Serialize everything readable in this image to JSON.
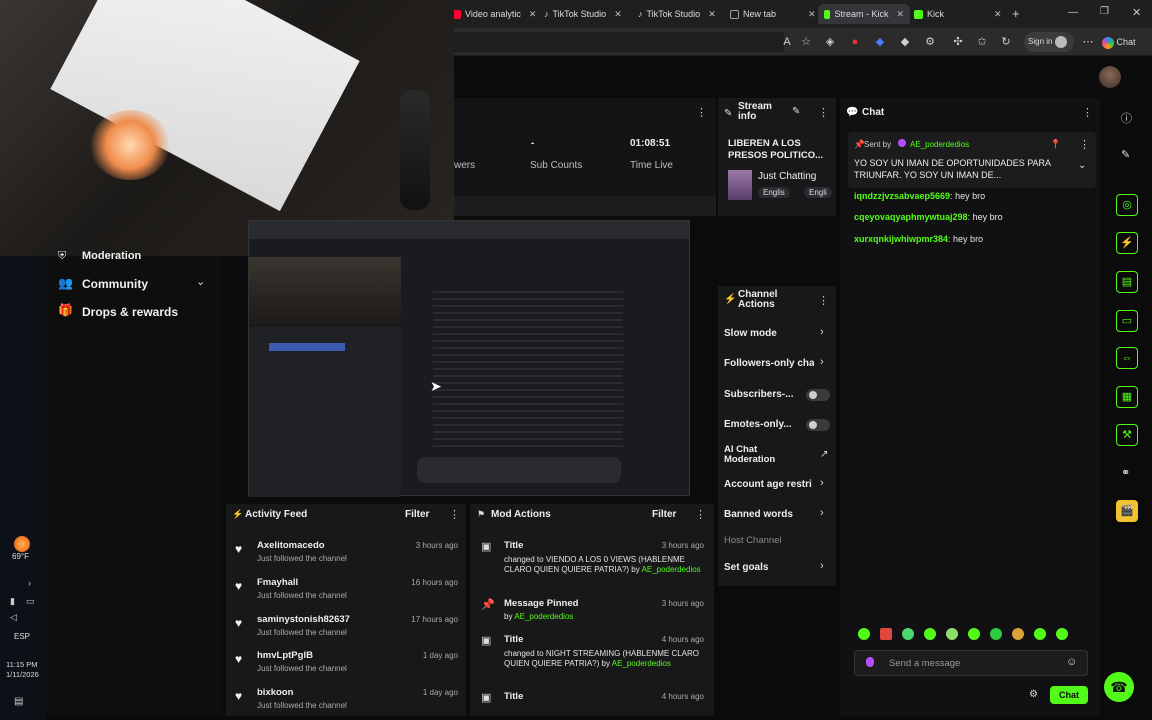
{
  "browser": {
    "tabs": [
      {
        "label": "Video analytic",
        "color": "#ff0033"
      },
      {
        "label": "TikTok Studio",
        "color": "#ffffff"
      },
      {
        "label": "TikTok Studio",
        "color": "#ffffff"
      },
      {
        "label": "New tab",
        "color": "#9aa0a6"
      },
      {
        "label": "Stream - Kick",
        "color": "#53fc18"
      },
      {
        "label": "Kick",
        "color": "#53fc18"
      }
    ],
    "sign_in": "Sign in",
    "chat_label": "Chat"
  },
  "stats": {
    "viewers_value": "-",
    "viewers_label": "wers",
    "subs_value": "-",
    "subs_label": "Sub Counts",
    "time_value": "01:08:51",
    "time_label": "Time Live"
  },
  "sidebar": {
    "items": [
      "Moderation",
      "Community",
      "Drops & rewards"
    ]
  },
  "stream_info": {
    "header": "Stream info",
    "title": "LIBEREN A LOS PRESOS POLITICO...",
    "category": "Just Chatting",
    "tags": [
      "Englis",
      "Engli"
    ]
  },
  "channel_actions": {
    "header": "Channel Actions",
    "items": [
      {
        "label": "Slow mode",
        "kind": "chevron"
      },
      {
        "label": "Followers-only cha",
        "kind": "chevron"
      },
      {
        "label": "Subscribers-...",
        "kind": "toggle"
      },
      {
        "label": "Emotes-only...",
        "kind": "toggle"
      },
      {
        "label": "AI Chat Moderation",
        "kind": "external"
      },
      {
        "label": "Account age restri",
        "kind": "chevron"
      },
      {
        "label": "Banned words",
        "kind": "chevron"
      },
      {
        "label": "Host Channel",
        "kind": "disabled"
      },
      {
        "label": "Set goals",
        "kind": "chevron"
      }
    ]
  },
  "chat": {
    "header": "Chat",
    "pinned_sender_prefix": "Sent by",
    "pinned_sender": "AE_poderdedios",
    "pinned_text": "YO SOY UN IMAN DE OPORTUNIDADES PARA TRIUNFAR. YO SOY UN IMAN DE...",
    "messages": [
      {
        "user": "iqndzzjvzsabvaep5669",
        "text": "hey bro"
      },
      {
        "user": "cqeyovaqyaphmywtuaj298",
        "text": "hey bro"
      },
      {
        "user": "xurxqnkijwhiwpmr384",
        "text": "hey bro"
      }
    ],
    "input_placeholder": "Send a message",
    "send_label": "Chat"
  },
  "activity_feed": {
    "header": "Activity Feed",
    "filter": "Filter",
    "items": [
      {
        "name": "Axelitomacedo",
        "sub": "Just followed the channel",
        "time": "3 hours ago"
      },
      {
        "name": "Fmayhall",
        "sub": "Just followed the channel",
        "time": "16 hours ago"
      },
      {
        "name": "saminystonish82637",
        "sub": "Just followed the channel",
        "time": "17 hours ago"
      },
      {
        "name": "hmvLptPglB",
        "sub": "Just followed the channel",
        "time": "1 day ago"
      },
      {
        "name": "bixkoon",
        "sub": "Just followed the channel",
        "time": "1 day ago"
      }
    ]
  },
  "mod_actions": {
    "header": "Mod Actions",
    "filter": "Filter",
    "items": [
      {
        "title": "Title",
        "body": "changed to VIENDO A LOS 0 VIEWS (HABLENME CLARO QUIEN QUIERE PATRIA?) by",
        "by": "AE_poderdedios",
        "time": "3 hours ago"
      },
      {
        "title": "Message Pinned",
        "body": "by",
        "by": "AE_poderdedios",
        "time": "3 hours ago"
      },
      {
        "title": "Title",
        "body": "changed to NIGHT STREAMING (HABLENME CLARO QUIEN QUIERE PATRIA?) by",
        "by": "AE_poderdedios",
        "time": "4 hours ago"
      },
      {
        "title": "Title",
        "body": "",
        "by": "",
        "time": "4 hours ago"
      }
    ]
  },
  "taskbar": {
    "temp": "69°F",
    "lang": "ESP",
    "time": "11:15 PM",
    "date": "1/11/2026"
  },
  "colors": {
    "accent": "#53fc18",
    "panel": "#18181b",
    "bg": "#0b0b0c"
  }
}
